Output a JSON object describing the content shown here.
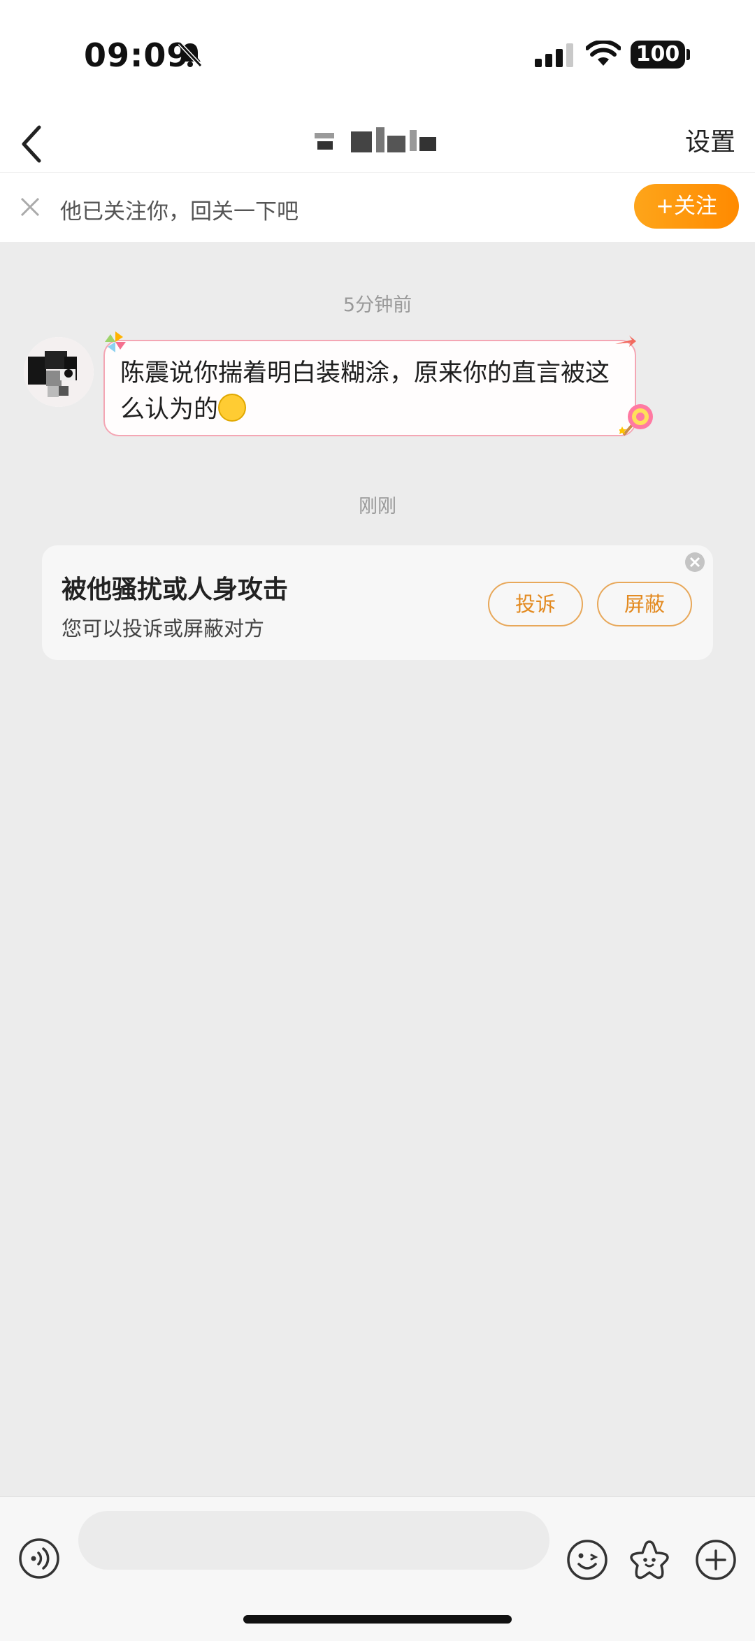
{
  "status_bar": {
    "time": "09:09",
    "battery": "100",
    "icons": [
      "bell-muted-icon",
      "cellular-signal-icon",
      "wifi-icon",
      "battery-icon"
    ]
  },
  "nav": {
    "title": "",
    "settings_label": "设置",
    "icons": [
      "back-chevron-icon"
    ]
  },
  "follow_banner": {
    "text": "他已关注你，回关一下吧",
    "button_label": "+关注",
    "icons": [
      "close-icon"
    ]
  },
  "messages": [
    {
      "timestamp": "5分钟前",
      "text": "陈震说你揣着明白装糊涂，原来你的直言被这么认为的",
      "emoji": "laughing-tears-emoji"
    }
  ],
  "notice_timestamp": "刚刚",
  "harass_card": {
    "title": "被他骚扰或人身攻击",
    "subtitle": "您可以投诉或屏蔽对方",
    "report_label": "投诉",
    "block_label": "屏蔽",
    "icons": [
      "close-circle-icon"
    ]
  },
  "input_bar": {
    "placeholder": "",
    "icons": [
      "voice-icon",
      "emoji-smile-icon",
      "sticker-star-icon",
      "plus-circle-icon"
    ]
  },
  "colors": {
    "accent_orange": "#ff8a00",
    "bubble_border": "#f4a6b4",
    "background": "#ececec"
  }
}
